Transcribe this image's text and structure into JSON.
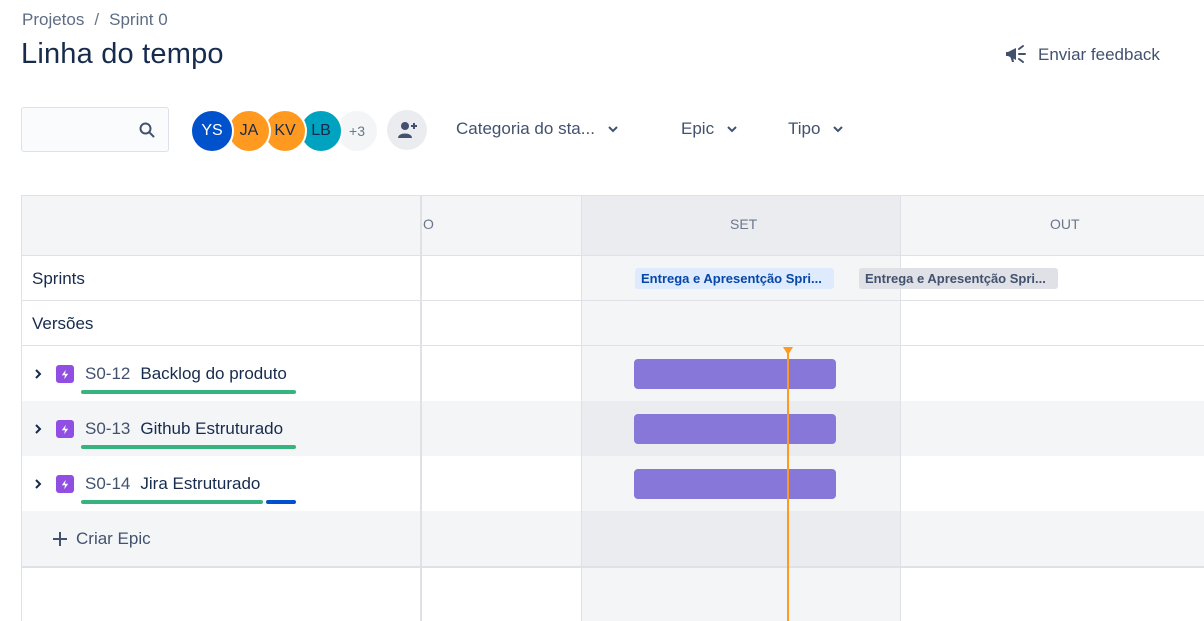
{
  "breadcrumb": {
    "items": [
      "Projetos",
      "Sprint 0"
    ],
    "separator": "/"
  },
  "page": {
    "title": "Linha do tempo"
  },
  "header": {
    "feedback_label": "Enviar feedback"
  },
  "search": {
    "placeholder": ""
  },
  "avatars": [
    {
      "initials": "YS",
      "bg": "#0052cc",
      "fg": "#ffffff"
    },
    {
      "initials": "JA",
      "bg": "#ff991f",
      "fg": "#172b4d"
    },
    {
      "initials": "KV",
      "bg": "#ff991f",
      "fg": "#172b4d"
    },
    {
      "initials": "LB",
      "bg": "#00a3bf",
      "fg": "#172b4d"
    }
  ],
  "avatars_more": "+3",
  "filters": {
    "status_category": "Categoria do sta...",
    "epic": "Epic",
    "type": "Tipo"
  },
  "timeline": {
    "months": [
      "O",
      "SET",
      "OUT"
    ],
    "rows": {
      "sprints": "Sprints",
      "versions": "Versões"
    },
    "sprints": [
      {
        "label": "Entrega e Apresentção Spri...",
        "status": "active"
      },
      {
        "label": "Entrega e Apresentção Spri...",
        "status": "future"
      }
    ],
    "epics": [
      {
        "key": "S0-12",
        "summary": "Backlog do produto",
        "progress_done": 1.0,
        "progress_inprogress": 0.0
      },
      {
        "key": "S0-13",
        "summary": "Github Estruturado",
        "progress_done": 1.0,
        "progress_inprogress": 0.0
      },
      {
        "key": "S0-14",
        "summary": "Jira Estruturado",
        "progress_done": 0.85,
        "progress_inprogress": 0.15
      }
    ],
    "create_epic_label": "Criar Epic"
  },
  "colors": {
    "done": "#36b37e",
    "in_progress": "#0052cc",
    "epic_bar": "#8777d9",
    "today_marker": "#ff991f",
    "epic_icon": "#904ee2"
  }
}
